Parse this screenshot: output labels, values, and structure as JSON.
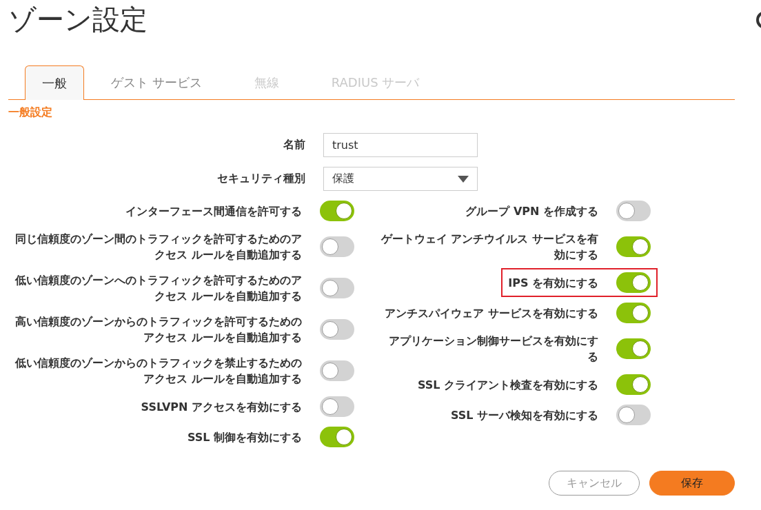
{
  "title": "ゾーン設定",
  "tabs": [
    {
      "label": "一般",
      "selected": true,
      "disabled": false
    },
    {
      "label": "ゲスト サービス",
      "selected": false,
      "disabled": false
    },
    {
      "label": "無線",
      "selected": false,
      "disabled": true
    },
    {
      "label": "RADIUS サーバ",
      "selected": false,
      "disabled": true
    }
  ],
  "section_title": "一般設定",
  "fields": [
    {
      "kind": "text",
      "label": "名前",
      "value": "trust"
    },
    {
      "kind": "select",
      "label": "セキュリティ種別",
      "value": "保護"
    }
  ],
  "left_toggles": [
    {
      "label": "インターフェース間通信を許可する",
      "on": true,
      "highlighted": false
    },
    {
      "label": "同じ信頼度のゾーン間のトラフィックを許可するためのアクセス ルールを自動追加する",
      "on": false,
      "highlighted": false
    },
    {
      "label": "低い信頼度のゾーンへのトラフィックを許可するためのアクセス ルールを自動追加する",
      "on": false,
      "highlighted": false
    },
    {
      "label": "高い信頼度のゾーンからのトラフィックを許可するためのアクセス ルールを自動追加する",
      "on": false,
      "highlighted": false
    },
    {
      "label": "低い信頼度のゾーンからのトラフィックを禁止するためのアクセス ルールを自動追加する",
      "on": false,
      "highlighted": false
    },
    {
      "label": "SSLVPN アクセスを有効にする",
      "on": false,
      "highlighted": false
    },
    {
      "label": "SSL 制御を有効にする",
      "on": true,
      "highlighted": false
    }
  ],
  "right_toggles": [
    {
      "label": "グループ VPN を作成する",
      "on": false,
      "highlighted": false
    },
    {
      "label": "ゲートウェイ アンチウイルス サービスを有効にする",
      "on": true,
      "highlighted": false
    },
    {
      "label": "IPS を有効にする",
      "on": true,
      "highlighted": true
    },
    {
      "label": "アンチスパイウェア サービスを有効にする",
      "on": true,
      "highlighted": false
    },
    {
      "label": "アプリケーション制御サービスを有効にする",
      "on": true,
      "highlighted": false
    },
    {
      "label": "SSL クライアント検査を有効にする",
      "on": true,
      "highlighted": false
    },
    {
      "label": "SSL サーバ検知を有効にする",
      "on": false,
      "highlighted": false
    }
  ],
  "buttons": [
    {
      "kind": "secondary",
      "label": "キャンセル"
    },
    {
      "kind": "primary",
      "label": "保存"
    }
  ]
}
